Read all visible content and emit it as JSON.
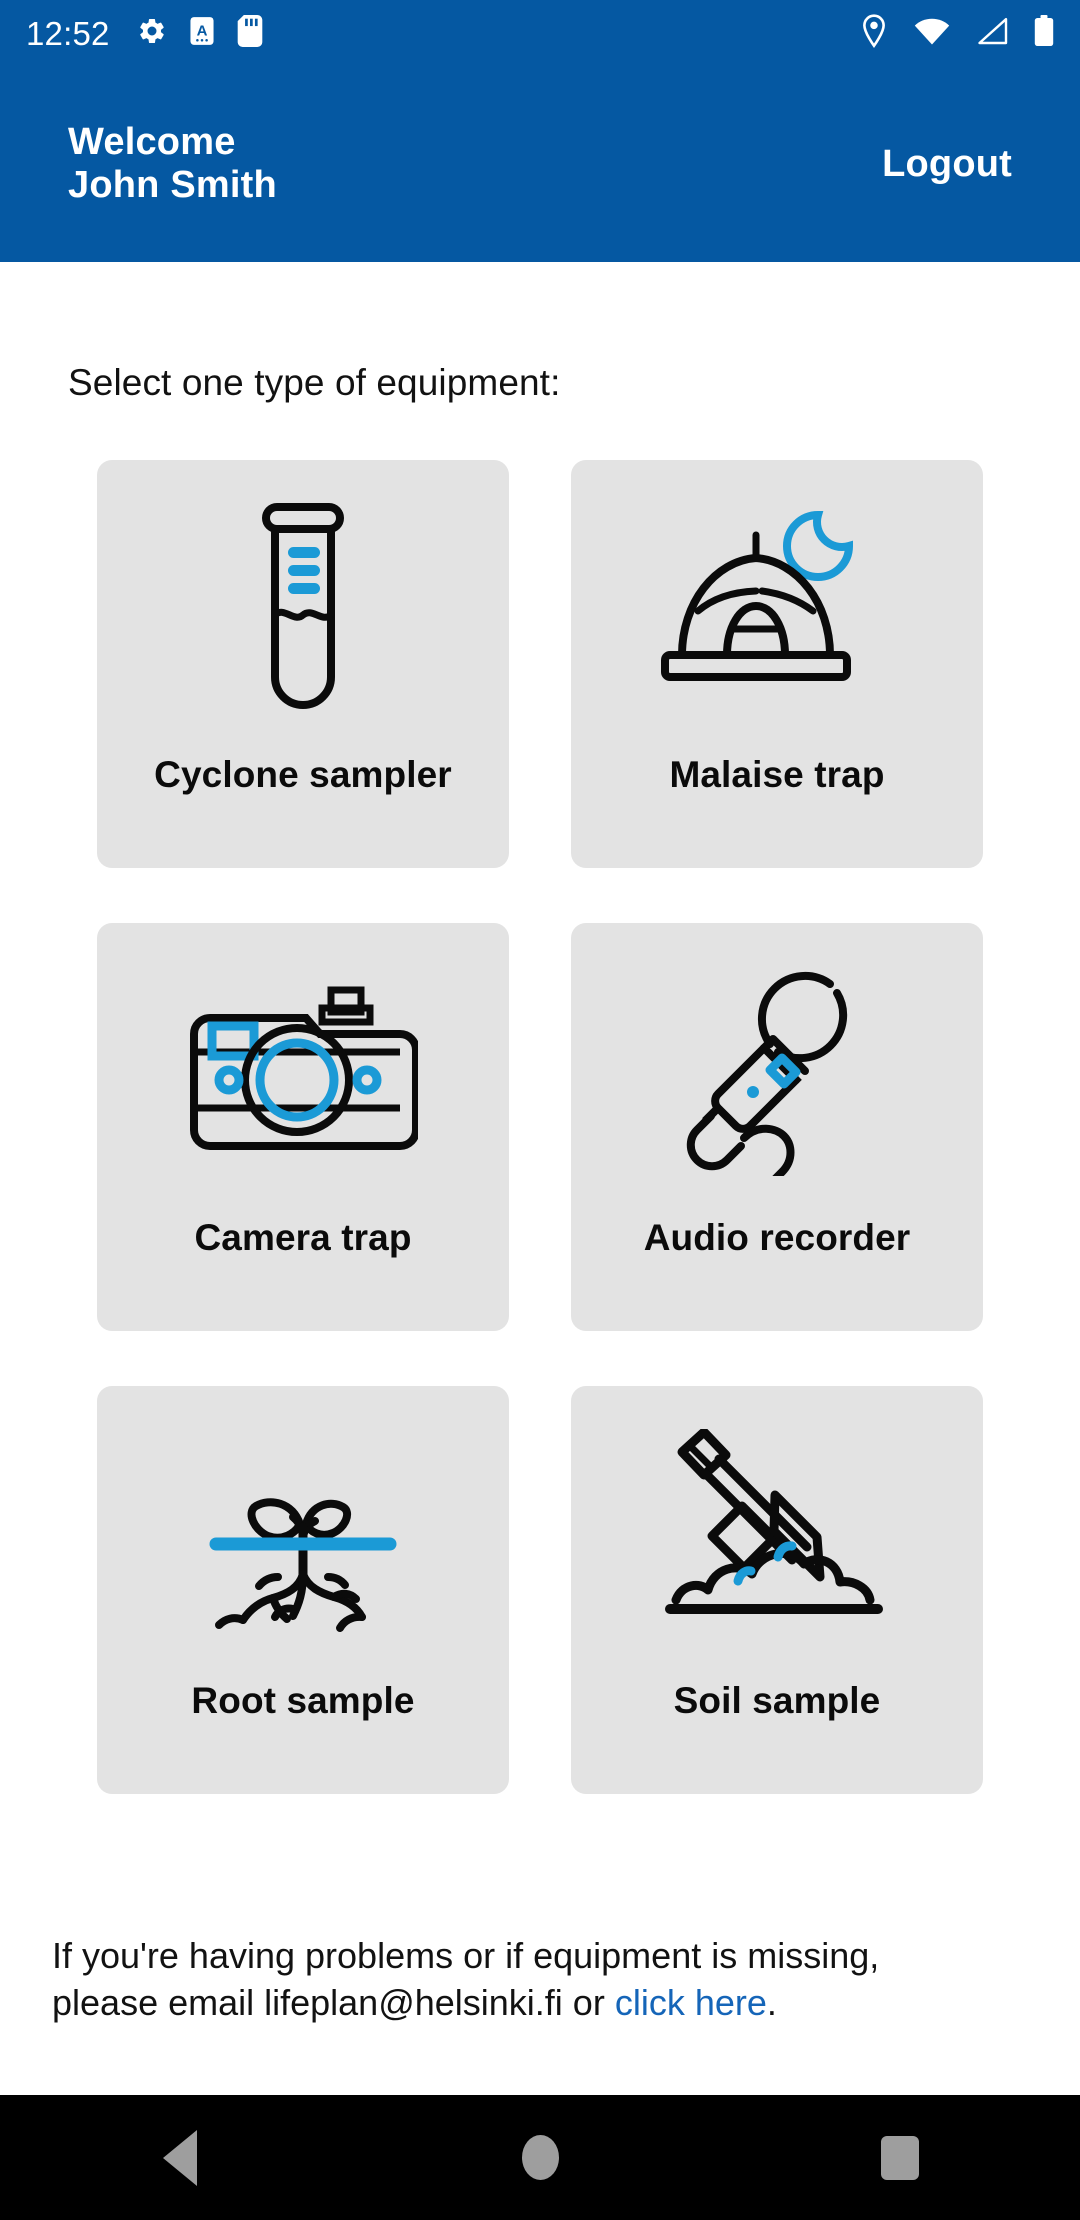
{
  "colors": {
    "brand_blue": "#0558a2",
    "accent_blue": "#1b9ad6",
    "link_blue": "#1565b8",
    "card_bg": "#e3e3e3",
    "nav_bg": "#000000",
    "icon_stroke": "#0b0b0b"
  },
  "status_bar": {
    "time": "12:52",
    "left_icons": [
      "gear-icon",
      "keyboard-language-a-icon",
      "sd-card-icon"
    ],
    "right_icons": [
      "location-pin-icon",
      "wifi-icon",
      "cellular-signal-icon",
      "battery-icon"
    ]
  },
  "header": {
    "welcome_label": "Welcome",
    "user_name": "John Smith",
    "logout_label": "Logout"
  },
  "main": {
    "prompt": "Select one type of equipment:",
    "equipment": [
      {
        "label": "Cyclone sampler",
        "icon": "test-tube-icon"
      },
      {
        "label": "Malaise trap",
        "icon": "tent-moon-icon"
      },
      {
        "label": "Camera trap",
        "icon": "camera-icon"
      },
      {
        "label": "Audio recorder",
        "icon": "microphone-icon"
      },
      {
        "label": "Root sample",
        "icon": "seedling-roots-icon"
      },
      {
        "label": "Soil sample",
        "icon": "shovel-soil-icon"
      }
    ]
  },
  "footer": {
    "line1": "If you're having problems or if equipment is missing,",
    "line2_before": "please email lifeplan@helsinki.fi or ",
    "link_text": "click here",
    "line2_after": "."
  },
  "navigation_bar": {
    "back_label": "Back",
    "home_label": "Home",
    "recents_label": "Recents"
  }
}
